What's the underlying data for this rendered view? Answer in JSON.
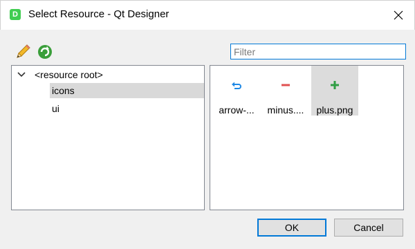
{
  "window": {
    "app_icon_letter": "D",
    "title": "Select Resource - Qt Designer",
    "close_glyph": "✕"
  },
  "toolbar": {
    "edit_icon": "pencil-icon",
    "reload_icon": "reload-icon"
  },
  "filter": {
    "value": "",
    "placeholder": "Filter"
  },
  "tree": {
    "root": "<resource root>",
    "items": [
      {
        "label": "icons",
        "selected": true
      },
      {
        "label": "ui",
        "selected": false
      }
    ]
  },
  "files": [
    {
      "label": "arrow-...",
      "icon": "arrow-back-icon",
      "selected": false
    },
    {
      "label": "minus....",
      "icon": "minus-icon",
      "selected": false
    },
    {
      "label": "plus.png",
      "icon": "plus-icon",
      "selected": true
    }
  ],
  "buttons": {
    "ok": "OK",
    "cancel": "Cancel"
  },
  "colors": {
    "accent": "#0078d7",
    "selection": "#d9d9d9",
    "minus": "#e05050",
    "plus": "#2f9e44"
  }
}
